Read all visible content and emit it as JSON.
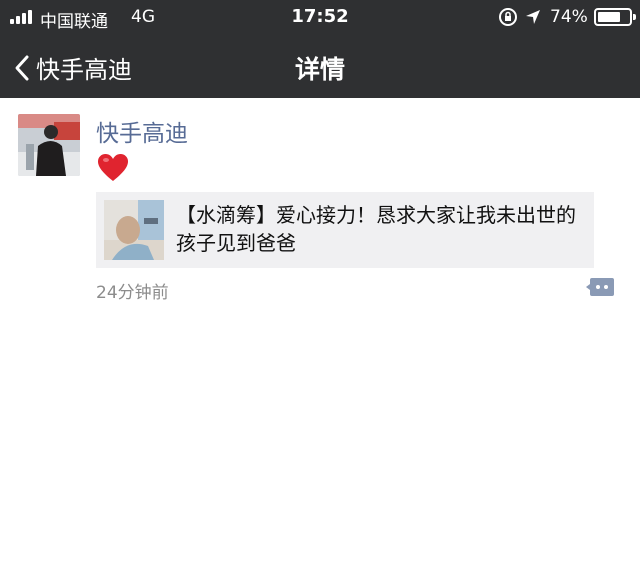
{
  "status_bar": {
    "carrier": "中国联通",
    "network": "4G",
    "time": "17:52",
    "battery": "74%",
    "battery_level": 0.74
  },
  "nav": {
    "back_label": "快手高迪",
    "title": "详情"
  },
  "post": {
    "username": "快手高迪",
    "content_icon": "heart-emoji",
    "share_title": "【水滴筹】爱心接力！恳求大家让我未出世的孩子见到爸爸",
    "time_ago": "24分钟前"
  },
  "colors": {
    "nav_bg": "#2f3032",
    "name_link": "#576b95",
    "share_bg": "#f0f0f2",
    "meta_text": "#8c8c8c",
    "heart": "#e0242f"
  }
}
